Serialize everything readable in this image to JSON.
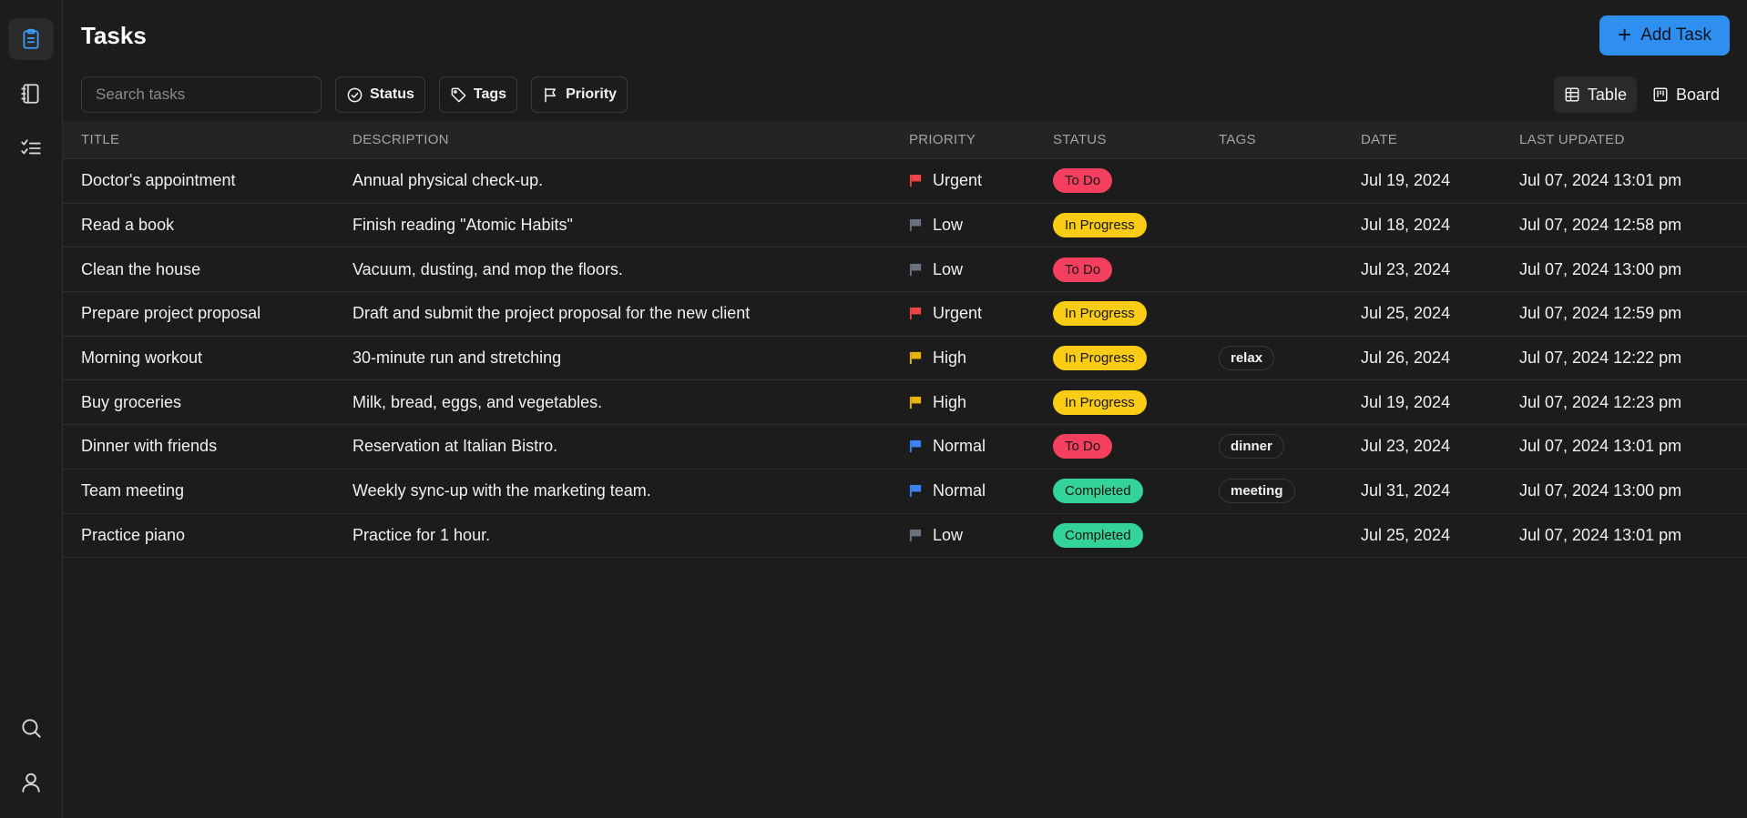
{
  "header": {
    "title": "Tasks",
    "add_button_label": "Add Task"
  },
  "filters": {
    "search_placeholder": "Search tasks",
    "status_label": "Status",
    "tags_label": "Tags",
    "priority_label": "Priority"
  },
  "views": {
    "table_label": "Table",
    "board_label": "Board",
    "active": "Table"
  },
  "colors": {
    "accent": "#2f8ff0",
    "todo": "#f43f5e",
    "in_progress": "#facc15",
    "completed": "#34d399",
    "flag_urgent": "#ef4444",
    "flag_high": "#eab308",
    "flag_normal": "#3b82f6",
    "flag_low": "#6b7280"
  },
  "table": {
    "columns": [
      "TITLE",
      "DESCRIPTION",
      "PRIORITY",
      "STATUS",
      "TAGS",
      "DATE",
      "LAST UPDATED"
    ],
    "rows": [
      {
        "title": "Doctor's appointment",
        "description": "Annual physical check-up.",
        "priority": "Urgent",
        "status": "To Do",
        "tag": "",
        "date": "Jul 19, 2024",
        "updated": "Jul 07, 2024 13:01 pm"
      },
      {
        "title": "Read a book",
        "description": "Finish reading \"Atomic Habits\"",
        "priority": "Low",
        "status": "In Progress",
        "tag": "",
        "date": "Jul 18, 2024",
        "updated": "Jul 07, 2024 12:58 pm"
      },
      {
        "title": "Clean the house",
        "description": "Vacuum, dusting, and mop the floors.",
        "priority": "Low",
        "status": "To Do",
        "tag": "",
        "date": "Jul 23, 2024",
        "updated": "Jul 07, 2024 13:00 pm"
      },
      {
        "title": "Prepare project proposal",
        "description": "Draft and submit the project proposal for the new client",
        "priority": "Urgent",
        "status": "In Progress",
        "tag": "",
        "date": "Jul 25, 2024",
        "updated": "Jul 07, 2024 12:59 pm"
      },
      {
        "title": "Morning workout",
        "description": "30-minute run and stretching",
        "priority": "High",
        "status": "In Progress",
        "tag": "relax",
        "date": "Jul 26, 2024",
        "updated": "Jul 07, 2024 12:22 pm"
      },
      {
        "title": "Buy groceries",
        "description": "Milk, bread, eggs, and vegetables.",
        "priority": "High",
        "status": "In Progress",
        "tag": "",
        "date": "Jul 19, 2024",
        "updated": "Jul 07, 2024 12:23 pm"
      },
      {
        "title": "Dinner with friends",
        "description": "Reservation at Italian Bistro.",
        "priority": "Normal",
        "status": "To Do",
        "tag": "dinner",
        "date": "Jul 23, 2024",
        "updated": "Jul 07, 2024 13:01 pm"
      },
      {
        "title": "Team meeting",
        "description": "Weekly sync-up with the marketing team.",
        "priority": "Normal",
        "status": "Completed",
        "tag": "meeting",
        "date": "Jul 31, 2024",
        "updated": "Jul 07, 2024 13:00 pm"
      },
      {
        "title": "Practice piano",
        "description": "Practice for 1 hour.",
        "priority": "Low",
        "status": "Completed",
        "tag": "",
        "date": "Jul 25, 2024",
        "updated": "Jul 07, 2024 13:01 pm"
      }
    ]
  }
}
